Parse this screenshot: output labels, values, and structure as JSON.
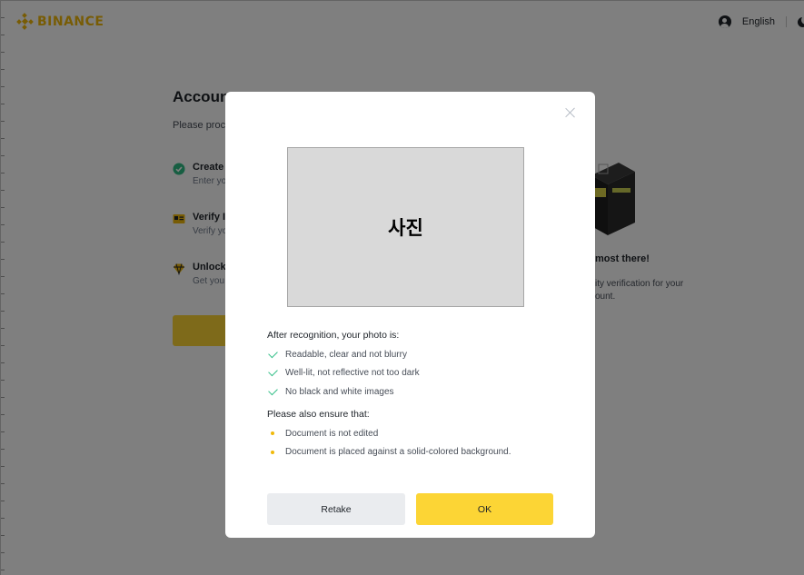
{
  "brand": {
    "name": "BINANCE",
    "color": "#f0b90b"
  },
  "header": {
    "language": "English",
    "user_icon": "user-icon",
    "theme_icon": "moon-icon"
  },
  "background": {
    "title": "Accoun",
    "subtitle": "Please proc",
    "steps": [
      {
        "title": "Create",
        "desc": "Enter yo",
        "icon": "check-circle-icon"
      },
      {
        "title": "Verify I",
        "desc": "Verify yo",
        "icon": "id-card-icon"
      },
      {
        "title": "Unlock",
        "desc": "Get you",
        "icon": "diamond-icon"
      }
    ],
    "side_title": "most there!",
    "side_text_line1": "ity verification for your",
    "side_text_line2": "ount."
  },
  "modal": {
    "photo_label": "사진",
    "recognition_heading": "After recognition, your photo is:",
    "recognition_items": [
      "Readable, clear and not blurry",
      "Well-lit, not reflective not too dark",
      "No black and white images"
    ],
    "ensure_heading": "Please also ensure that:",
    "ensure_items": [
      "Document is not edited",
      "Document is placed against a solid-colored background."
    ],
    "retake_label": "Retake",
    "ok_label": "OK"
  },
  "colors": {
    "accent_yellow": "#fcd535",
    "check_green": "#2ebd85",
    "overlay": "rgba(0,0,0,0.5)"
  }
}
